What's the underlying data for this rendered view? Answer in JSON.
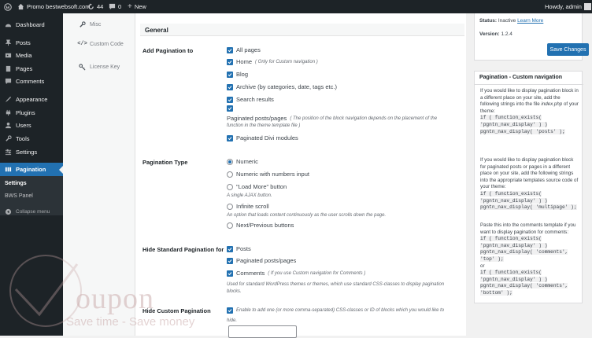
{
  "admin_bar": {
    "site_name": "Promo bestwebsoft.com",
    "updates_count": "44",
    "comments_count": "0",
    "new_label": "New",
    "greeting": "Howdy, admin"
  },
  "sidebar": {
    "items": [
      {
        "label": "Dashboard",
        "icon": "dashboard-icon"
      },
      {
        "label": "Posts",
        "icon": "pin-icon"
      },
      {
        "label": "Media",
        "icon": "media-icon"
      },
      {
        "label": "Pages",
        "icon": "page-icon"
      },
      {
        "label": "Comments",
        "icon": "comment-icon"
      },
      {
        "label": "Appearance",
        "icon": "brush-icon"
      },
      {
        "label": "Plugins",
        "icon": "plugin-icon"
      },
      {
        "label": "Users",
        "icon": "users-icon"
      },
      {
        "label": "Tools",
        "icon": "wrench-icon"
      },
      {
        "label": "Settings",
        "icon": "settings-icon"
      },
      {
        "label": "Pagination",
        "icon": "pagination-icon"
      }
    ],
    "submenu": [
      "Settings",
      "BWS Panel"
    ],
    "collapse_label": "Collapse menu"
  },
  "tabs": [
    {
      "label": "Misc",
      "icon": "wrench-icon"
    },
    {
      "label": "Custom Code",
      "icon": "code-icon"
    },
    {
      "label": "License Key",
      "icon": "key-icon"
    }
  ],
  "main": {
    "section_title": "General",
    "add_pagination": {
      "label": "Add Pagination to",
      "all_pages": "All pages",
      "home": "Home",
      "home_note": "( Only for Custom navigation )",
      "blog": "Blog",
      "archive": "Archive (by categories, date, tags etc.)",
      "search": "Search results",
      "paginated": "Paginated posts/pages",
      "paginated_note_1": "( The position of the block navigation depends on the placement of the",
      "paginated_note_2": "function in the theme template file )",
      "divi": "Paginated Divi modules"
    },
    "pagination_type": {
      "label": "Pagination Type",
      "numeric": "Numeric",
      "numeric_input": "Numeric with numbers input",
      "load_more": "\"Load More\" button",
      "load_more_note": "A single AJAX button.",
      "infinite": "Infinite scroll",
      "infinite_note": "An option that loads content continuously as the user scrolls down the page.",
      "next_prev": "Next/Previous buttons"
    },
    "hide_standard": {
      "label": "Hide Standard Pagination for",
      "posts": "Posts",
      "paginated": "Paginated posts/pages",
      "comments": "Comments",
      "comments_note": "( If you use Custom navigation for Comments )",
      "desc_1": "Used for standard WordPress themes or themes, which use standard CSS-classes to display pagination",
      "desc_2": "blocks."
    },
    "hide_custom": {
      "label": "Hide Custom Pagination",
      "desc_1": "Enable to add one (or more comma-separated) CSS-classes or ID of blocks which you would like to",
      "desc_2": "hide.",
      "input_value": ""
    }
  },
  "rail": {
    "status_label": "Status:",
    "status_value": "Inactive",
    "learn_more": "Learn More",
    "version_label": "Version:",
    "version_value": "1.2.4",
    "save_label": "Save Changes",
    "custom_nav": {
      "title": "Pagination - Custom navigation",
      "p1": "If you would like to display pagination block in a different place on your site, add the following strings into the file ",
      "p1_file": "index.php",
      "p1_end": " of your theme:",
      "code1": [
        "if ( function_exists(",
        "'pgntn_nav_display' ) )",
        "pgntn_nav_display( 'posts' );"
      ],
      "p2": "If you would like to display pagination block for paginated posts or pages in a different place on your site, add the following strings into the appropriate templates source code of your theme:",
      "code2": [
        "if ( function_exists(",
        "'pgntn_nav_display' ) )",
        "pgntn_nav_display( 'multipage' );"
      ],
      "p3": "Paste this into the comments template if you want to display pagination for comments:",
      "code3": [
        "if ( function_exists(",
        "'pgntn_nav_display' ) )",
        "pgntn_nav_display( 'comments',",
        "'top' );"
      ],
      "or": "or",
      "code4": [
        "if ( function_exists(",
        "'pgntn_nav_display' ) )",
        "pgntn_nav_display( 'comments',",
        "'bottom' );"
      ]
    }
  },
  "watermark": {
    "brand": "oupon",
    "tagline": "Save time - Save money"
  },
  "colors": {
    "admin_dark": "#1d2327",
    "accent_blue": "#2271b1",
    "watermark": "#c9a8a8"
  }
}
